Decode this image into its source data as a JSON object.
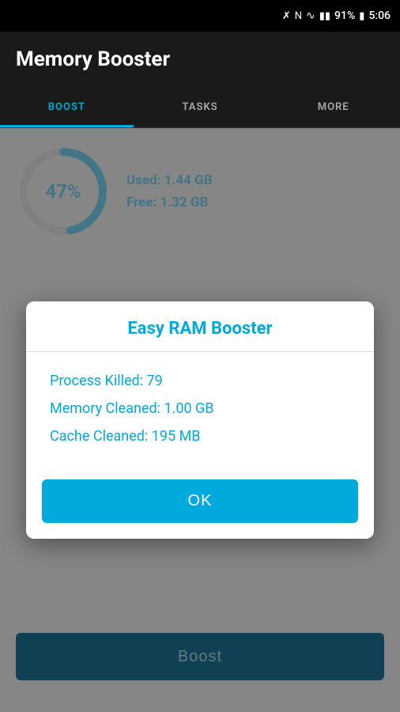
{
  "statusBar": {
    "battery": "91%",
    "time": "5:06"
  },
  "header": {
    "title": "Memory Booster"
  },
  "tabs": [
    {
      "label": "BOOST",
      "active": true
    },
    {
      "label": "TASKS",
      "active": false
    },
    {
      "label": "MORE",
      "active": false
    }
  ],
  "memoryStats": {
    "percent": "47%",
    "usedLabel": "Used:",
    "usedValue": "1.44 GB",
    "freeLabel": "Free:",
    "freeValue": "1.32 GB"
  },
  "boostButton": {
    "label": "Boost"
  },
  "dialog": {
    "title": "Easy RAM Booster",
    "processKilledLabel": "Process Killed:",
    "processKilledValue": "79",
    "memoryCleanedLabel": "Memory Cleaned:",
    "memoryCleanedValue": "1.00 GB",
    "cacheCleanedLabel": "Cache Cleaned:",
    "cacheCleanedValue": "195 MB",
    "okButton": "OK"
  },
  "colors": {
    "accent": "#00aadd",
    "headerBg": "#1a1a1a",
    "dialogTitleColor": "#00aadd",
    "tabActive": "#00aadd"
  }
}
